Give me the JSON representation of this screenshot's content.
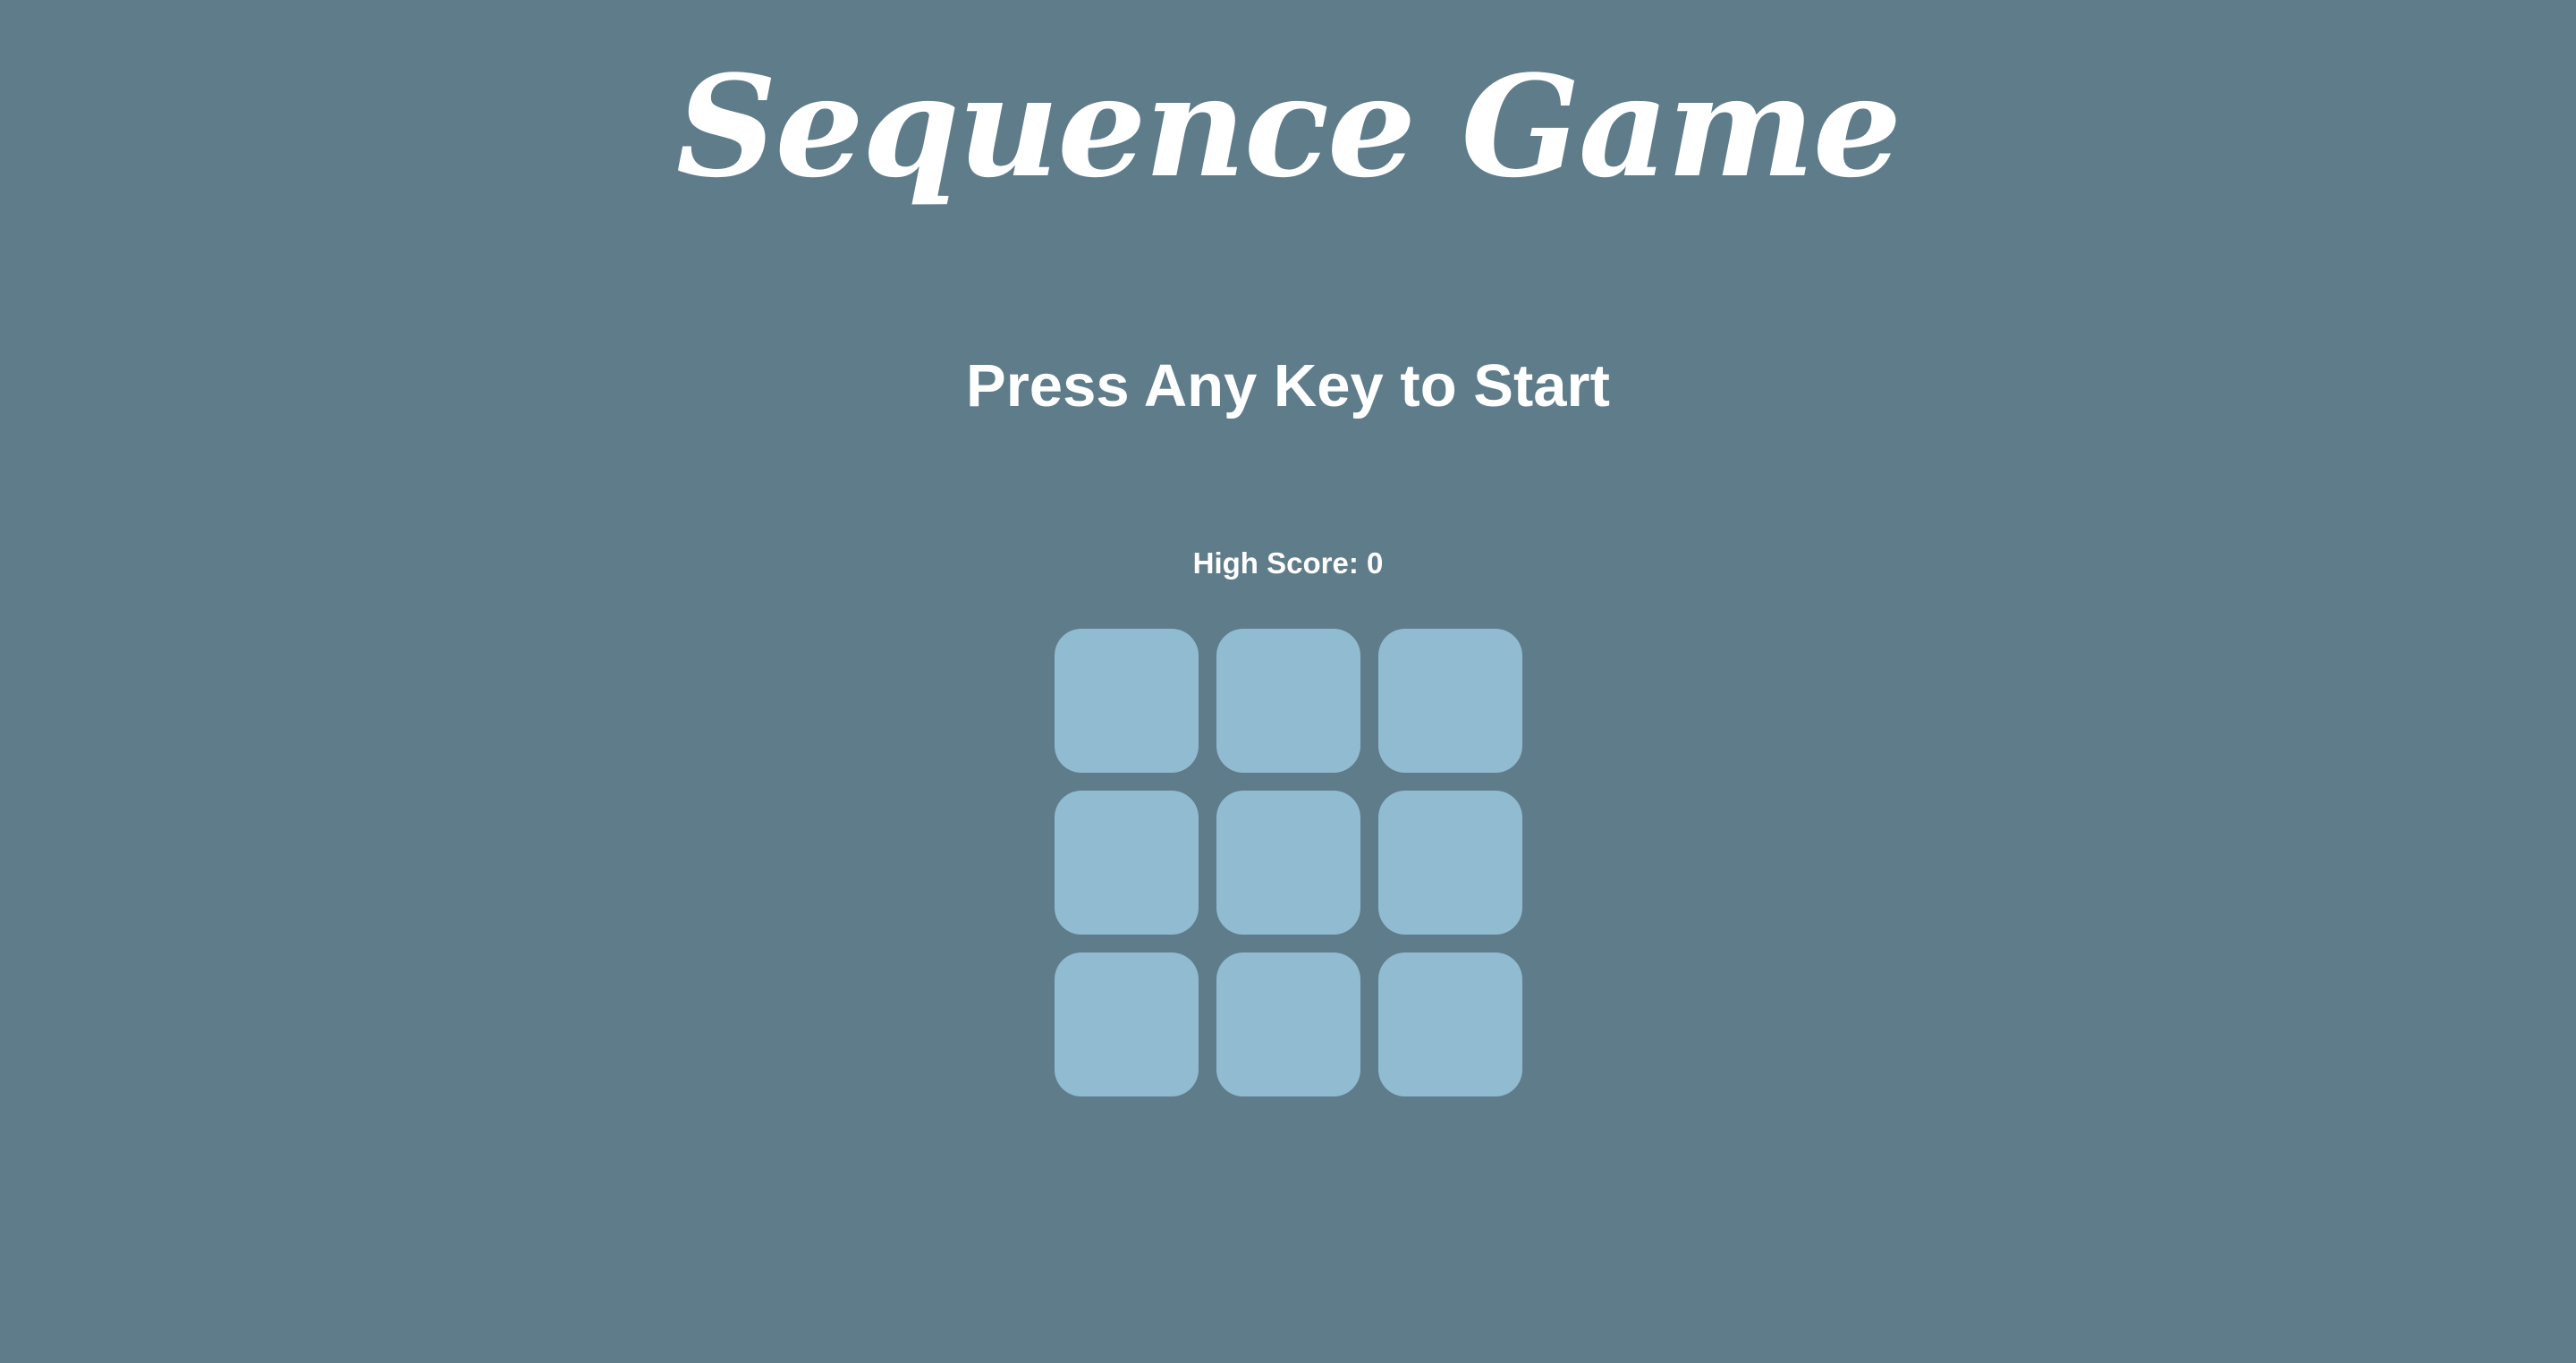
{
  "title": "Sequence Game",
  "status_text": "Press Any Key to Start",
  "high_score": {
    "label": "High Score:",
    "value": "0",
    "display": "High Score: 0"
  },
  "colors": {
    "background": "#5e7c8a",
    "tile": "#91bbd1",
    "text": "#ffffff"
  },
  "tiles": [
    {
      "id": "tile-1"
    },
    {
      "id": "tile-2"
    },
    {
      "id": "tile-3"
    },
    {
      "id": "tile-4"
    },
    {
      "id": "tile-5"
    },
    {
      "id": "tile-6"
    },
    {
      "id": "tile-7"
    },
    {
      "id": "tile-8"
    },
    {
      "id": "tile-9"
    }
  ]
}
